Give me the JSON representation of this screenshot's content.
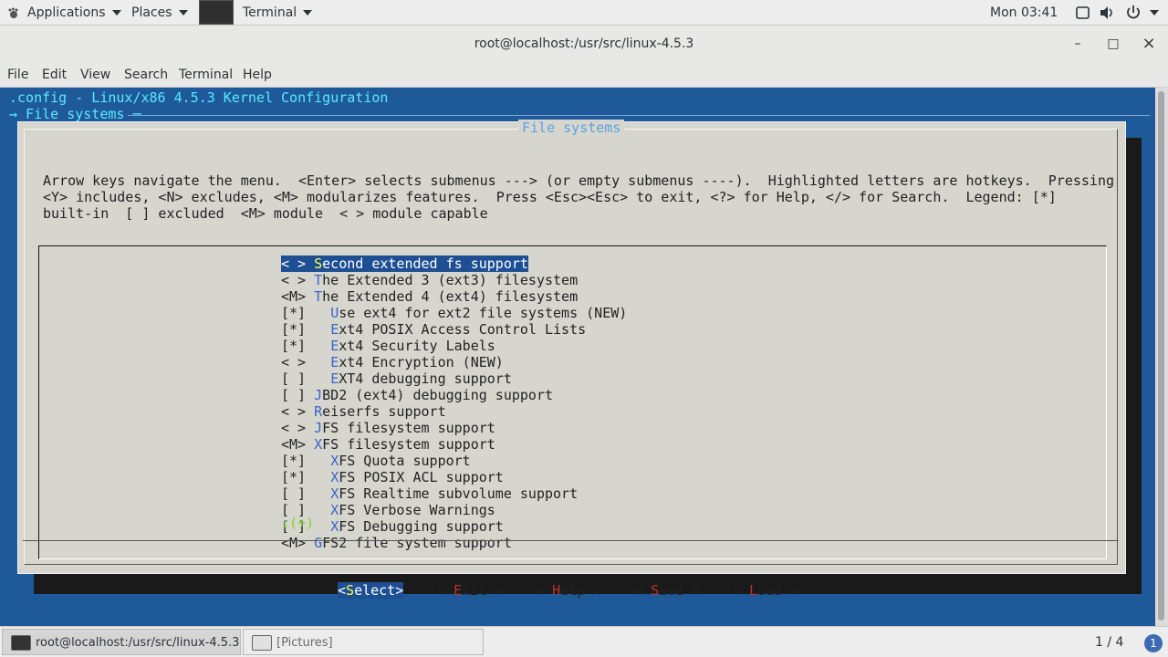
{
  "topbar": {
    "applications": "Applications",
    "places": "Places",
    "terminal_app": "Terminal",
    "clock": "Mon 03:41"
  },
  "window": {
    "title": "root@localhost:/usr/src/linux-4.5.3",
    "minimize": "–",
    "maximize": "□",
    "close": "×"
  },
  "menubar": [
    "File",
    "Edit",
    "View",
    "Search",
    "Terminal",
    "Help"
  ],
  "terminal": {
    "config_title": ".config - Linux/x86 4.5.3 Kernel Configuration",
    "breadcrumb": "→ File systems ─"
  },
  "dialog": {
    "title": "File systems",
    "help_lines": [
      "Arrow keys navigate the menu.  <Enter> selects submenus ---> (or empty submenus ----).  Highlighted letters are hotkeys.  Pressing",
      "<Y> includes, <N> excludes, <M> modularizes features.  Press <Esc><Esc> to exit, <?> for Help, </> for Search.  Legend: [*]",
      "built-in  [ ] excluded  <M> module  < > module capable"
    ],
    "items": [
      {
        "prefix": "< > ",
        "hotkey": "S",
        "rest": "econd extended fs support"
      },
      {
        "prefix": "< > ",
        "hotkey": "T",
        "rest": "he Extended 3 (ext3) filesystem"
      },
      {
        "prefix": "<M> ",
        "hotkey": "T",
        "rest": "he Extended 4 (ext4) filesystem"
      },
      {
        "prefix": "[*]   ",
        "hotkey": "U",
        "rest": "se ext4 for ext2 file systems (NEW)"
      },
      {
        "prefix": "[*]   ",
        "hotkey": "E",
        "rest": "xt4 POSIX Access Control Lists"
      },
      {
        "prefix": "[*]   ",
        "hotkey": "E",
        "rest": "xt4 Security Labels"
      },
      {
        "prefix": "< >   ",
        "hotkey": "E",
        "rest": "xt4 Encryption (NEW)"
      },
      {
        "prefix": "[ ]   ",
        "hotkey": "E",
        "rest": "XT4 debugging support"
      },
      {
        "prefix": "[ ] ",
        "hotkey": "J",
        "rest": "BD2 (ext4) debugging support"
      },
      {
        "prefix": "< > ",
        "hotkey": "R",
        "rest": "eiserfs support"
      },
      {
        "prefix": "< > ",
        "hotkey": "J",
        "rest": "FS filesystem support"
      },
      {
        "prefix": "<M> ",
        "hotkey": "X",
        "rest": "FS filesystem support"
      },
      {
        "prefix": "[*]   ",
        "hotkey": "X",
        "rest": "FS Quota support"
      },
      {
        "prefix": "[*]   ",
        "hotkey": "X",
        "rest": "FS POSIX ACL support"
      },
      {
        "prefix": "[ ]   ",
        "hotkey": "X",
        "rest": "FS Realtime subvolume support"
      },
      {
        "prefix": "[ ]   ",
        "hotkey": "X",
        "rest": "FS Verbose Warnings"
      },
      {
        "prefix": "[ ]   ",
        "hotkey": "X",
        "rest": "FS Debugging support"
      },
      {
        "prefix": "<M> ",
        "hotkey": "G",
        "rest": "FS2 file system support"
      }
    ],
    "more_indicator": "↓(+)",
    "buttons": [
      {
        "pre": "<",
        "key": "S",
        "post": "elect>"
      },
      {
        "pre": "< ",
        "key": "E",
        "post": "xit >"
      },
      {
        "pre": "< ",
        "key": "H",
        "post": "elp >"
      },
      {
        "pre": "< ",
        "key": "S",
        "post": "ave >"
      },
      {
        "pre": "< ",
        "key": "L",
        "post": "oad >"
      }
    ]
  },
  "taskbar": {
    "tasks": [
      "root@localhost:/usr/src/linux-4.5.3",
      "[Pictures]"
    ],
    "pager": "1 / 4",
    "notification_count": "1"
  }
}
